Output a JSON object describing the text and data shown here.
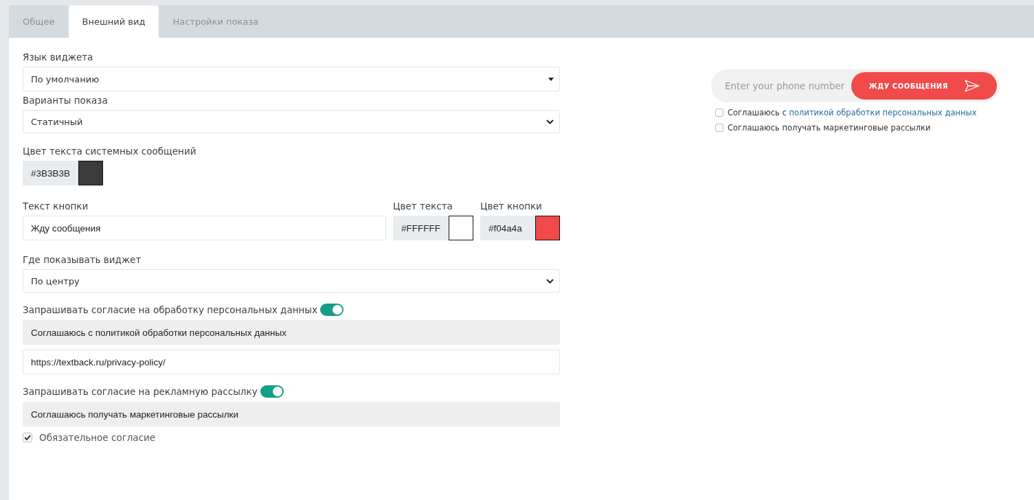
{
  "tabs": [
    {
      "label": "Общее",
      "selected": false
    },
    {
      "label": "Внешний вид",
      "selected": true
    },
    {
      "label": "Настройки показа",
      "selected": false
    }
  ],
  "language": {
    "label": "Язык виджета",
    "value": "По умолчанию"
  },
  "display_mode": {
    "label": "Варианты показа",
    "value": "Статичный"
  },
  "system_text_color": {
    "label": "Цвет текста системных сообщений",
    "value": "#3B3B3B"
  },
  "button_text": {
    "label": "Текст кнопки",
    "value": "Жду сообщения"
  },
  "text_color": {
    "label": "Цвет текста",
    "value": "#FFFFFF"
  },
  "button_color": {
    "label": "Цвет кнопки",
    "value": "#f04a4a"
  },
  "position": {
    "label": "Где показывать виджет",
    "value": "По центру"
  },
  "personal_data_consent": {
    "label": "Запрашивать согласие на обработку персональных данных",
    "on": true,
    "text": "Соглашаюсь с политикой обработки персональных данных",
    "url": "https://textback.ru/privacy-policy/"
  },
  "marketing_consent": {
    "label": "Запрашивать согласие на рекламную рассылку",
    "on": true,
    "text": "Соглашаюсь получать маркетинговые рассылки"
  },
  "required_consent": {
    "label": "Обязательное согласие",
    "checked": true
  },
  "preview": {
    "phone_placeholder": "Enter your phone number",
    "button_label": "ЖДУ СООБЩЕНИЯ",
    "consents": [
      {
        "text": "Соглашаюсь с ",
        "link": "политикой обработки персональных данных",
        "checked": false
      },
      {
        "text": "Соглашаюсь получать маркетинговые рассылки",
        "checked": false
      }
    ]
  }
}
